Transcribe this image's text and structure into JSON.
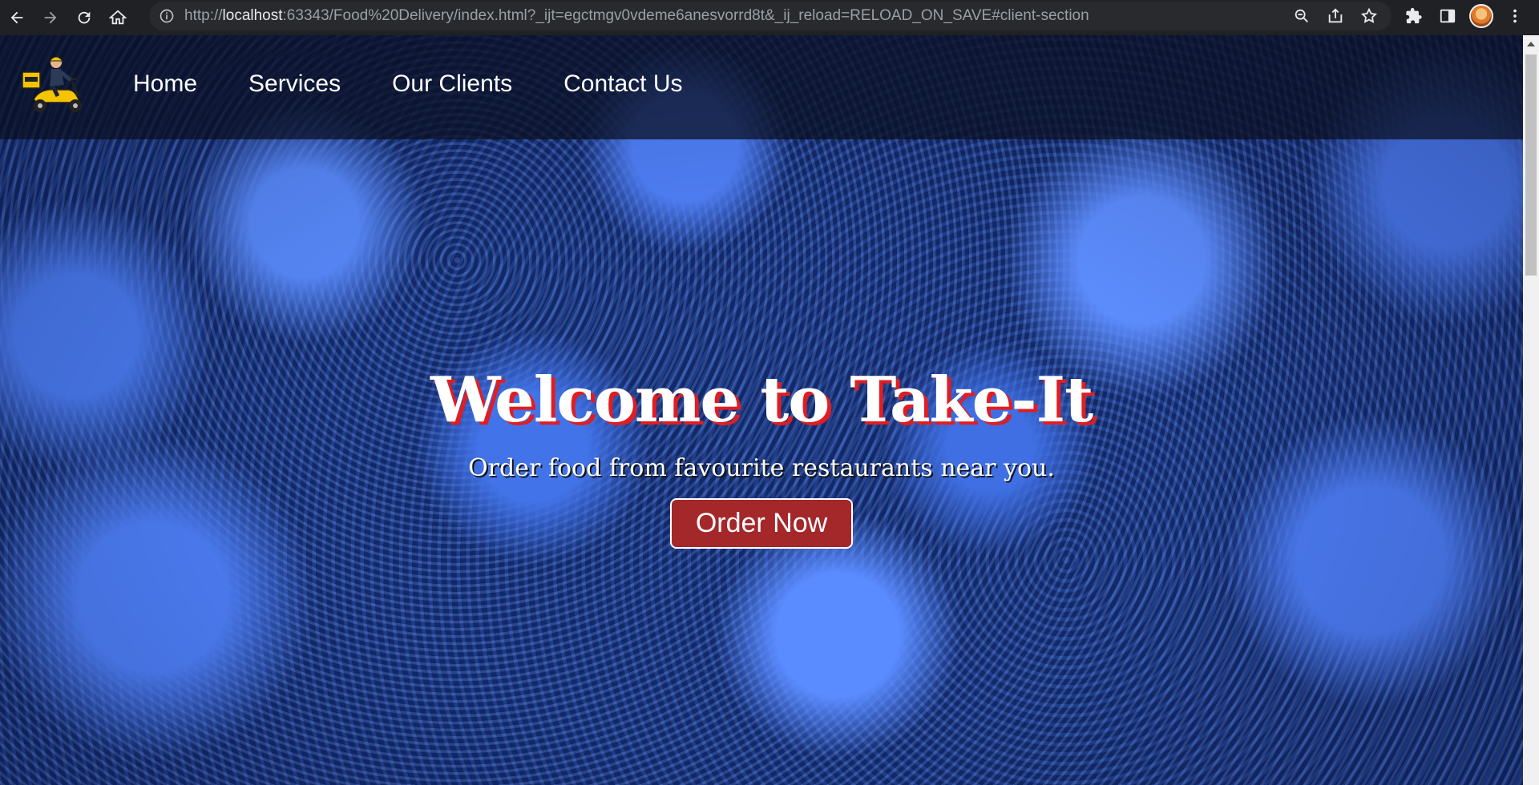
{
  "browser": {
    "url_prefix": "http://",
    "url_host": "localhost",
    "url_rest": ":63343/Food%20Delivery/index.html?_ijt=egctmgv0vdeme6anesvorrd8t&_ij_reload=RELOAD_ON_SAVE#client-section",
    "icons": [
      "back-icon",
      "forward-icon",
      "reload-icon",
      "home-icon",
      "info-icon",
      "zoom-icon",
      "share-icon",
      "star-icon",
      "extensions-icon",
      "sidepanel-icon",
      "kebab-menu-icon"
    ]
  },
  "header": {
    "logo_alt": "delivery-scooter-logo",
    "nav": [
      {
        "label": "Home"
      },
      {
        "label": "Services"
      },
      {
        "label": "Our Clients"
      },
      {
        "label": "Contact Us"
      }
    ]
  },
  "hero": {
    "title": "Welcome to Take-It",
    "subtitle": "Order food from favourite restaurants near you.",
    "cta_label": "Order Now"
  },
  "colors": {
    "title_shadow": "#e11d22",
    "cta_bg": "#a4272a",
    "header_bg": "rgba(10,14,30,0.72)"
  }
}
